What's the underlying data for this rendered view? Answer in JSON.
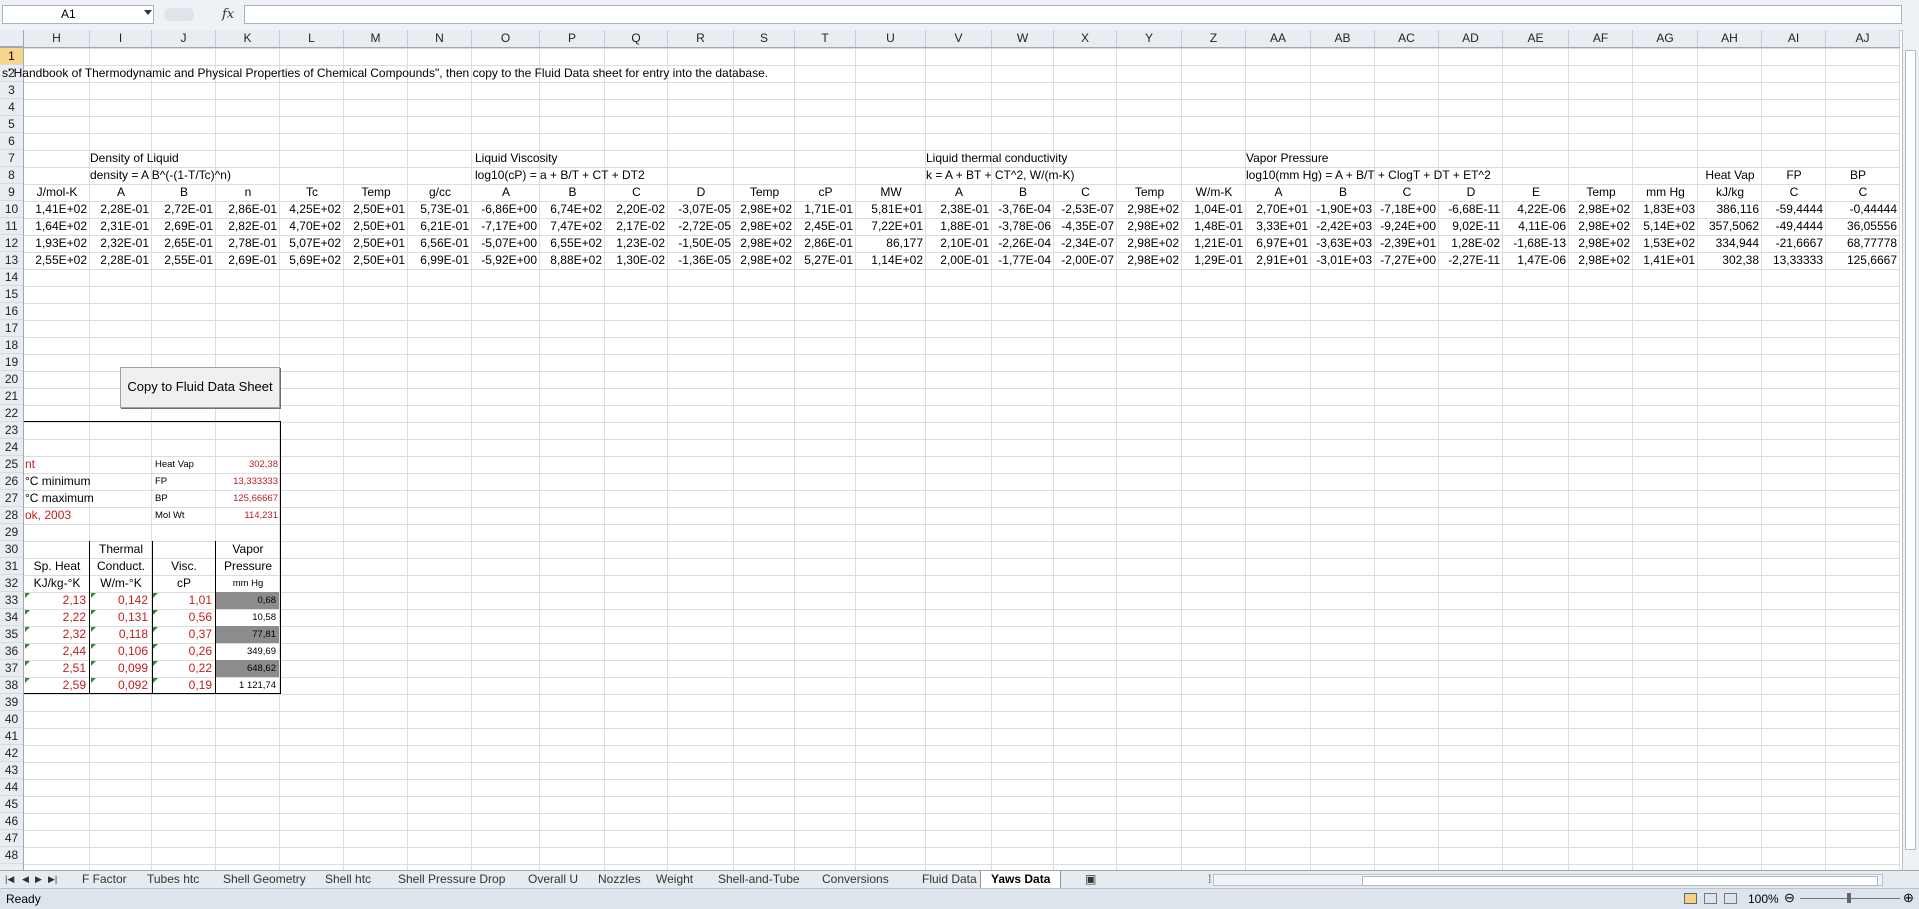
{
  "formula_bar": {
    "name_box": "A1",
    "fx": "fx",
    "formula": ""
  },
  "columns": [
    "H",
    "I",
    "J",
    "K",
    "L",
    "M",
    "N",
    "O",
    "P",
    "Q",
    "R",
    "S",
    "T",
    "U",
    "V",
    "W",
    "X",
    "Y",
    "Z",
    "AA",
    "AB",
    "AC",
    "AD",
    "AE",
    "AF",
    "AG",
    "AH",
    "AI",
    "AJ"
  ],
  "rows": [
    "1",
    "2",
    "3",
    "4",
    "5",
    "6",
    "7",
    "8",
    "9",
    "10",
    "11",
    "12",
    "13",
    "14",
    "15",
    "16",
    "17",
    "18",
    "19",
    "20",
    "21",
    "22",
    "23",
    "24",
    "25",
    "26",
    "27",
    "28",
    "29",
    "30",
    "31",
    "32",
    "33",
    "34",
    "35",
    "36",
    "37",
    "38",
    "39",
    "40",
    "41",
    "42",
    "43",
    "44",
    "45",
    "46",
    "47",
    "48"
  ],
  "sheet": {
    "row2_text": "s' Handbook of Thermodynamic and Physical Properties of Chemical Compounds\", then copy to the Fluid Data sheet for entry into the database.",
    "density_title": "Density of Liquid",
    "density_formula": "density = A B^(-(1-T/Tc)^n)",
    "viscosity_title": "Liquid Viscosity",
    "viscosity_formula": "log10(cP) = a + B/T + CT + DT2",
    "thermal_title": "Liquid thermal conductivity",
    "thermal_formula": "k = A + BT + CT^2, W/(m-K)",
    "vapor_title": "Vapor Pressure",
    "vapor_formula": "log10(mm Hg) = A + B/T + ClogT + DT + ET^2",
    "heat_vap_header": "Heat Vap",
    "fp_header": "FP",
    "bp_header": "BP",
    "units_row": [
      "J/mol-K",
      "A",
      "B",
      "n",
      "Tc",
      "Temp",
      "g/cc",
      "A",
      "B",
      "C",
      "D",
      "Temp",
      "cP",
      "MW",
      "A",
      "B",
      "C",
      "Temp",
      "W/m-K",
      "A",
      "B",
      "C",
      "D",
      "E",
      "Temp",
      "mm Hg",
      "kJ/kg",
      "C",
      "C"
    ],
    "data_rows": [
      [
        "1,41E+02",
        "2,28E-01",
        "2,72E-01",
        "2,86E-01",
        "4,25E+02",
        "2,50E+01",
        "5,73E-01",
        "-6,86E+00",
        "6,74E+02",
        "2,20E-02",
        "-3,07E-05",
        "2,98E+02",
        "1,71E-01",
        "5,81E+01",
        "2,38E-01",
        "-3,76E-04",
        "-2,53E-07",
        "2,98E+02",
        "1,04E-01",
        "2,70E+01",
        "-1,90E+03",
        "-7,18E+00",
        "-6,68E-11",
        "4,22E-06",
        "2,98E+02",
        "1,83E+03",
        "386,116",
        "-59,4444",
        "-0,44444"
      ],
      [
        "1,64E+02",
        "2,31E-01",
        "2,69E-01",
        "2,82E-01",
        "4,70E+02",
        "2,50E+01",
        "6,21E-01",
        "-7,17E+00",
        "7,47E+02",
        "2,17E-02",
        "-2,72E-05",
        "2,98E+02",
        "2,45E-01",
        "7,22E+01",
        "1,88E-01",
        "-3,78E-06",
        "-4,35E-07",
        "2,98E+02",
        "1,48E-01",
        "3,33E+01",
        "-2,42E+03",
        "-9,24E+00",
        "9,02E-11",
        "4,11E-06",
        "2,98E+02",
        "5,14E+02",
        "357,5062",
        "-49,4444",
        "36,05556"
      ],
      [
        "1,93E+02",
        "2,32E-01",
        "2,65E-01",
        "2,78E-01",
        "5,07E+02",
        "2,50E+01",
        "6,56E-01",
        "-5,07E+00",
        "6,55E+02",
        "1,23E-02",
        "-1,50E-05",
        "2,98E+02",
        "2,86E-01",
        "86,177",
        "2,10E-01",
        "-2,26E-04",
        "-2,34E-07",
        "2,98E+02",
        "1,21E-01",
        "6,97E+01",
        "-3,63E+03",
        "-2,39E+01",
        "1,28E-02",
        "-1,68E-13",
        "2,98E+02",
        "1,53E+02",
        "334,944",
        "-21,6667",
        "68,77778"
      ],
      [
        "2,55E+02",
        "2,28E-01",
        "2,55E-01",
        "2,69E-01",
        "5,69E+02",
        "2,50E+01",
        "6,99E-01",
        "-5,92E+00",
        "8,88E+02",
        "1,30E-02",
        "-1,36E-05",
        "2,98E+02",
        "5,27E-01",
        "1,14E+02",
        "2,00E-01",
        "-1,77E-04",
        "-2,00E-07",
        "2,98E+02",
        "1,29E-01",
        "2,91E+01",
        "-3,01E+03",
        "-7,27E+00",
        "-2,27E-11",
        "1,47E-06",
        "2,98E+02",
        "1,41E+01",
        "302,38",
        "13,33333",
        "125,6667"
      ]
    ],
    "button_label": "Copy to Fluid Data Sheet",
    "summary": {
      "r25_left": "nt",
      "r25_label": "Heat Vap",
      "r25_value": "302,38",
      "r26_left": "°C minimum",
      "r26_label": "FP",
      "r26_value": "13,333333",
      "r27_left": "°C maximum",
      "r27_label": "BP",
      "r27_value": "125,66667",
      "r28_left": "ok, 2003",
      "r28_label": "Mol Wt",
      "r28_value": "114,231"
    },
    "props_header": {
      "thermal_1": "Thermal",
      "vapor_1": "Vapor",
      "spheat_2": "Sp. Heat",
      "thermal_2": "Conduct.",
      "visc_2": "Visc.",
      "vapor_2": "Pressure",
      "spheat_3": "KJ/kg-°K",
      "thermal_3": "W/m-°K",
      "visc_3": "cP",
      "vapor_3": "mm Hg"
    },
    "props_rows": [
      [
        "2,13",
        "0,142",
        "1,01",
        "0,68"
      ],
      [
        "2,22",
        "0,131",
        "0,56",
        "10,58"
      ],
      [
        "2,32",
        "0,118",
        "0,37",
        "77,81"
      ],
      [
        "2,44",
        "0,106",
        "0,26",
        "349,69"
      ],
      [
        "2,51",
        "0,099",
        "0,22",
        "648,62"
      ],
      [
        "2,59",
        "0,092",
        "0,19",
        "1 121,74"
      ]
    ]
  },
  "tabs": [
    "F Factor",
    "Tubes htc",
    "Shell Geometry",
    "Shell htc",
    "Shell Pressure Drop",
    "Overall U",
    "Nozzles",
    "Weight",
    "Shell-and-Tube",
    "Conversions",
    "Fluid Data",
    "Yaws Data"
  ],
  "active_tab": "Yaws Data",
  "status": {
    "ready": "Ready",
    "zoom": "100%"
  }
}
